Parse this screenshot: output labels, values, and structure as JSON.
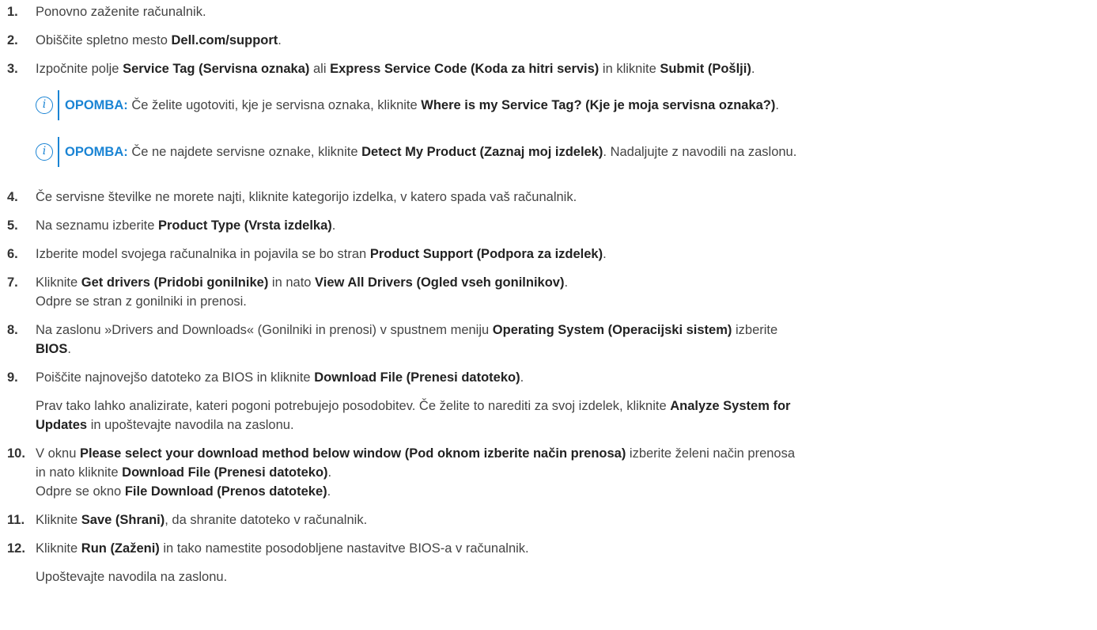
{
  "steps": [
    {
      "num": "1.",
      "parts": [
        "Ponovno zaženite računalnik."
      ]
    },
    {
      "num": "2.",
      "parts": [
        "Obiščite spletno mesto ",
        "Dell.com/support",
        "."
      ]
    },
    {
      "num": "3.",
      "parts": [
        "Izpočnite polje ",
        "Service Tag (Servisna oznaka)",
        " ali ",
        "Express Service Code (Koda za hitri servis)",
        " in kliknite ",
        "Submit (Pošlji)",
        "."
      ]
    },
    {
      "num": "4.",
      "parts": [
        "Če servisne številke ne morete najti, kliknite kategorijo izdelka, v katero spada vaš računalnik."
      ]
    },
    {
      "num": "5.",
      "parts": [
        "Na seznamu izberite ",
        "Product Type (Vrsta izdelka)",
        "."
      ]
    },
    {
      "num": "6.",
      "parts": [
        "Izberite model svojega računalnika in pojavila se bo stran ",
        "Product Support (Podpora za izdelek)",
        "."
      ]
    },
    {
      "num": "7.",
      "parts": [
        "Kliknite ",
        "Get drivers (Pridobi gonilnike)",
        " in nato ",
        "View All Drivers (Ogled vseh gonilnikov)",
        "."
      ]
    },
    {
      "num": "8.",
      "parts": [
        "Na zaslonu »Drivers and Downloads« (Gonilniki in prenosi) v spustnem meniju ",
        "Operating System (Operacijski sistem)",
        " izberite"
      ]
    },
    {
      "num": "9.",
      "parts": [
        "Poiščite najnovejšo datoteko za BIOS in kliknite ",
        "Download File (Prenesi datoteko)",
        "."
      ]
    },
    {
      "num": "10.",
      "parts": [
        "V oknu ",
        "Please select your download method below window (Pod oknom izberite način prenosa)",
        " izberite želeni način prenosa"
      ]
    },
    {
      "num": "11.",
      "parts": [
        "Kliknite ",
        "Save (Shrani)",
        ", da shranite datoteko v računalnik."
      ]
    },
    {
      "num": "12.",
      "parts": [
        "Kliknite ",
        "Run (Zaženi)",
        " in tako namestite posodobljene nastavitve BIOS-a v računalnik."
      ]
    }
  ],
  "notes": [
    {
      "label": "OPOMBA:",
      "parts": [
        " Če želite ugotoviti, kje je servisna oznaka, kliknite ",
        "Where is my Service Tag? (Kje je moja servisna oznaka?)",
        "."
      ]
    },
    {
      "label": "OPOMBA:",
      "parts": [
        " Če ne najdete servisne oznake, kliknite ",
        "Detect My Product (Zaznaj moj izdelek)",
        ". Nadaljujte z navodili na zaslonu."
      ]
    }
  ],
  "continuations": {
    "step7_result": "Odpre se stran z gonilniki in prenosi.",
    "step8_bios": "BIOS",
    "step8_end": ".",
    "step9_extra_1": [
      "Prav tako lahko analizirate, kateri pogoni potrebujejo posodobitev. Če želite to narediti za svoj izdelek, kliknite ",
      "Analyze System for"
    ],
    "step9_extra_2": [
      "Updates",
      " in upoštevajte navodila na zaslonu."
    ],
    "step10_line2": [
      "in nato kliknite ",
      "Download File (Prenesi datoteko)",
      "."
    ],
    "step10_line3": [
      "Odpre se okno ",
      "File Download (Prenos datoteke)",
      "."
    ],
    "step12_extra": "Upoštevajte navodila na zaslonu."
  },
  "icons": {
    "note_icon": "info-circle-icon"
  },
  "colors": {
    "note_accent": "#1a84d4",
    "text": "#444444"
  }
}
